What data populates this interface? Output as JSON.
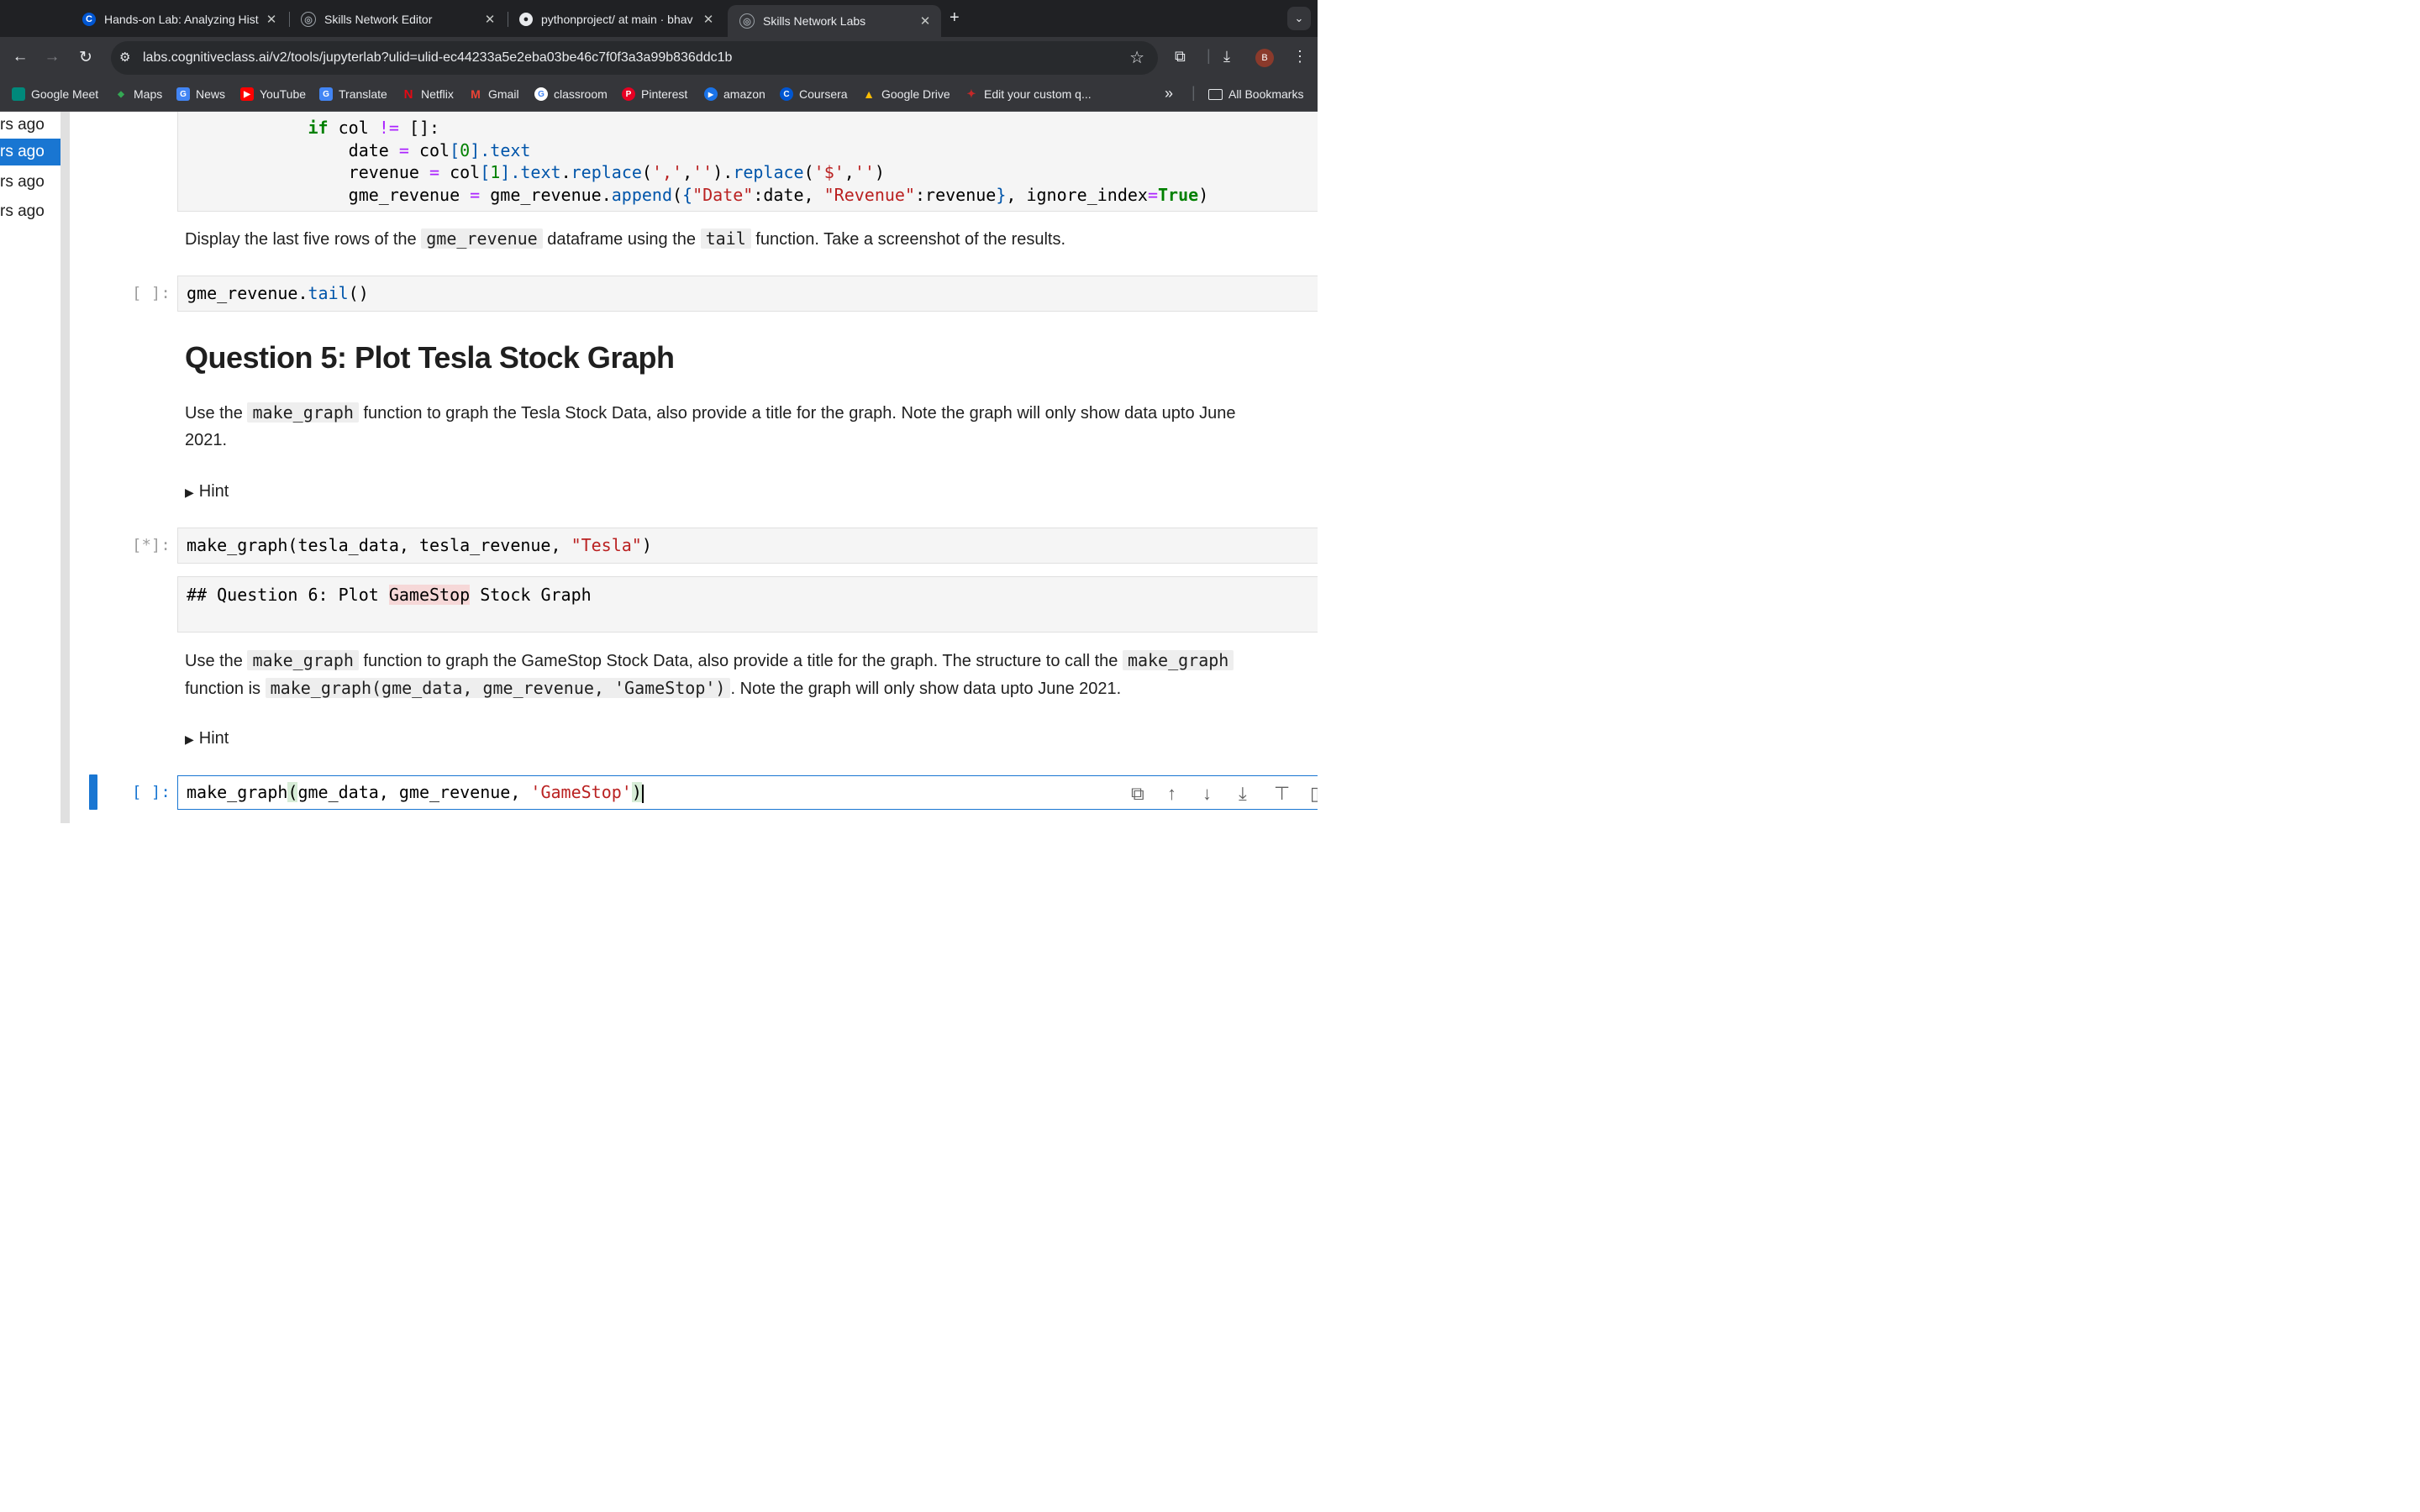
{
  "browser": {
    "tabs": [
      {
        "title": "Hands-on Lab: Analyzing Hist",
        "favicon": "coursera-icon"
      },
      {
        "title": "Skills Network Editor",
        "favicon": "skills-network-icon"
      },
      {
        "title": "pythonproject/ at main · bhav",
        "favicon": "github-icon"
      },
      {
        "title": "Skills Network Labs",
        "favicon": "skills-network-icon",
        "active": true
      }
    ],
    "close_glyph": "✕",
    "new_tab_glyph": "+",
    "url": "labs.cognitiveclass.ai/v2/tools/jupyterlab?ulid=ulid-ec44233a5e2eba03be46c7f0f3a3a99b836ddc1b",
    "profile_initial": "B",
    "bookmarks": [
      "Google Meet",
      "Maps",
      "News",
      "YouTube",
      "Translate",
      "Netflix",
      "Gmail",
      "classroom",
      "Pinterest",
      "amazon",
      "Coursera",
      "Google Drive",
      "Edit your custom q..."
    ],
    "all_bookmarks": "All Bookmarks",
    "more_glyph": "»"
  },
  "sidebar": {
    "history": [
      "rs ago",
      "rs ago",
      "rs ago",
      "rs ago"
    ],
    "selected_index": 1
  },
  "notebook": {
    "loop_code": {
      "line1": [
        "if",
        " col ",
        "!=",
        " []:"
      ],
      "line2": [
        "date ",
        "=",
        " col",
        "[",
        "0",
        "].",
        "text"
      ],
      "line3": [
        "revenue ",
        "=",
        " col",
        "[",
        "1",
        "].",
        "text",
        ".",
        "replace",
        "(",
        "','",
        ",",
        "''",
        ").",
        "replace",
        "(",
        "'$'",
        ",",
        "''",
        ")"
      ],
      "line4": [
        "gme_revenue ",
        "=",
        " gme_revenue.",
        "append",
        "(",
        "{",
        "\"Date\"",
        ":date, ",
        "\"Revenue\"",
        ":revenue",
        "}",
        ", ignore_index",
        "=",
        "True",
        ")"
      ]
    },
    "md1": {
      "before": "Display the last five rows of the ",
      "code1": "gme_revenue",
      "middle": " dataframe using the ",
      "code2": "tail",
      "after": " function. Take a screenshot of the results."
    },
    "cell_tail": {
      "prompt": "[ ]:",
      "obj": "gme_revenue.",
      "fn": "tail",
      "rest": "()"
    },
    "question5_heading": "Question 5: Plot Tesla Stock Graph",
    "md2": {
      "before": "Use the ",
      "code": "make_graph",
      "after": " function to graph the Tesla Stock Data, also provide a title for the graph. Note the graph will only show data upto June",
      "line2": "2021."
    },
    "hint_label": "Hint",
    "hint_glyph": "▶",
    "cell_tesla": {
      "prompt": "[*]:",
      "code": "make_graph(tesla_data, tesla_revenue, ",
      "str": "\"Tesla\"",
      "close": ")"
    },
    "raw_cell": {
      "before": "## Question 6: Plot ",
      "highlight": "GameStop",
      "after": " Stock Graph"
    },
    "md3": {
      "before": "Use the ",
      "code1": "make_graph",
      "middle": " function to graph the GameStop Stock Data, also provide a title for the graph. The structure to call the ",
      "code2": "make_graph",
      "line2_before": "function is ",
      "code3": "make_graph(gme_data, gme_revenue, 'GameStop')",
      "line2_after": ". Note the graph will only show data upto June 2021."
    },
    "cell_gme": {
      "prompt": "[ ]:",
      "fn": "make_graph",
      "open": "(",
      "args": "gme_data, gme_revenue, ",
      "str": "'GameStop'",
      "close": ")"
    }
  },
  "colors": {
    "accent": "#1976d2",
    "keyword": "#008000",
    "string": "#ba2121",
    "operator": "#aa22ff"
  }
}
